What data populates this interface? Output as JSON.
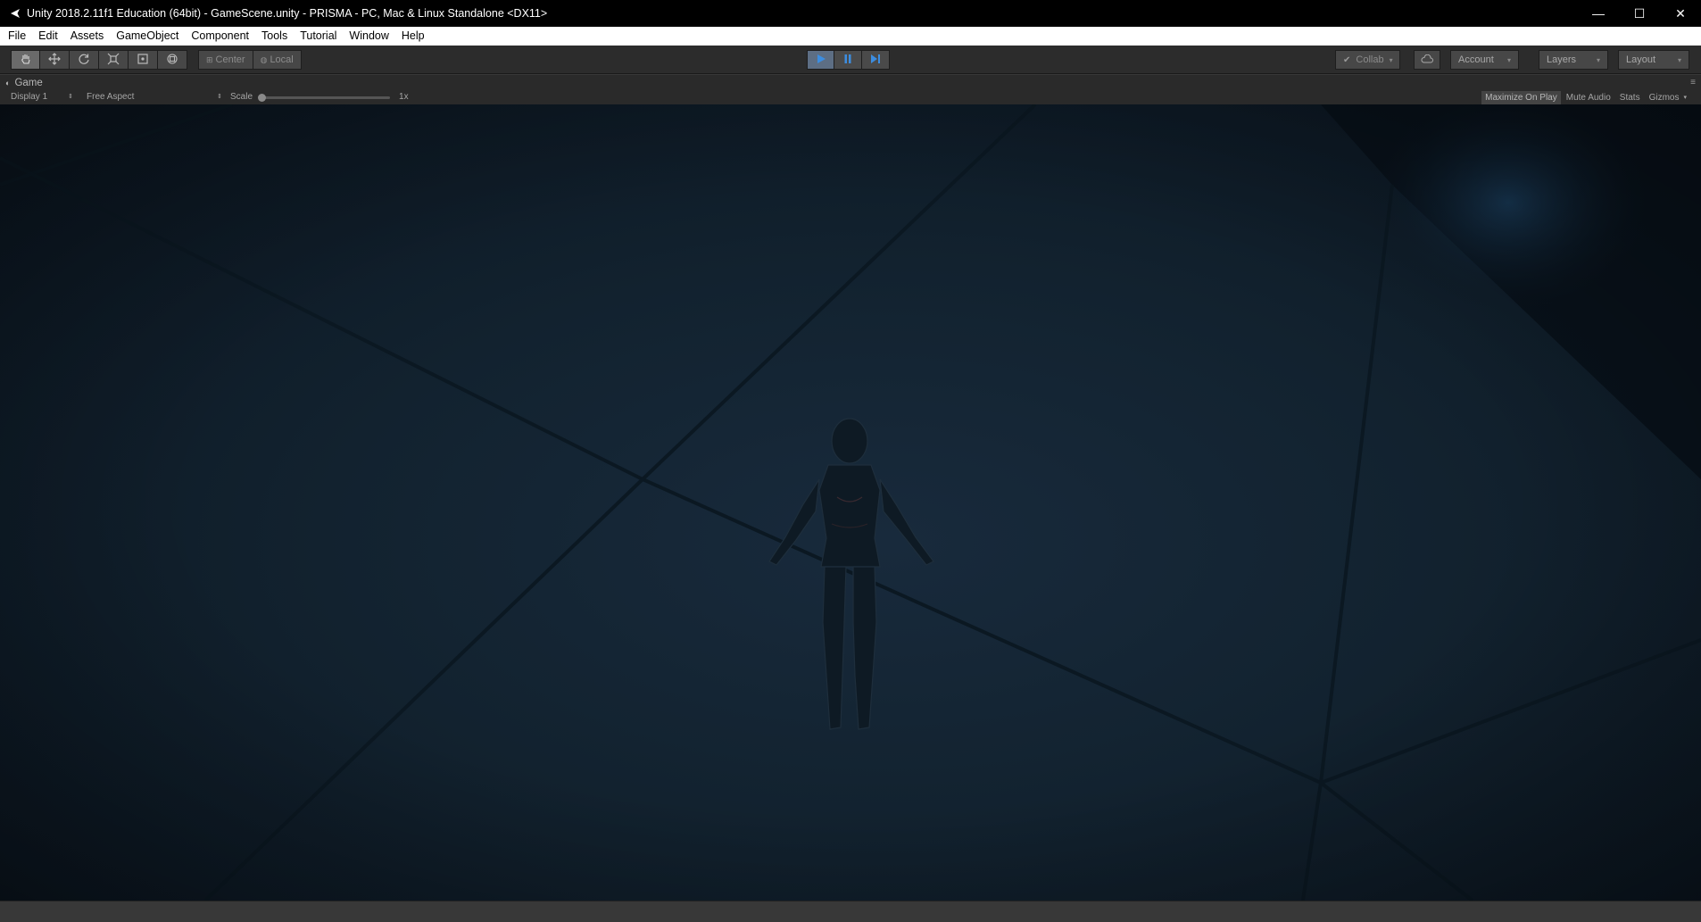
{
  "window": {
    "title": "Unity 2018.2.11f1 Education (64bit) - GameScene.unity - PRISMA - PC, Mac & Linux Standalone <DX11>",
    "minimize_glyph": "—",
    "maximize_glyph": "☐",
    "close_glyph": "✕"
  },
  "menu": {
    "items": [
      "File",
      "Edit",
      "Assets",
      "GameObject",
      "Component",
      "Tools",
      "Tutorial",
      "Window",
      "Help"
    ]
  },
  "toolbar": {
    "tools": [
      {
        "name": "hand-tool",
        "icon": "hand-icon",
        "active": true
      },
      {
        "name": "move-tool",
        "icon": "move-arrows-icon",
        "active": false
      },
      {
        "name": "rotate-tool",
        "icon": "rotate-icon",
        "active": false
      },
      {
        "name": "scale-tool",
        "icon": "scale-icon",
        "active": false
      },
      {
        "name": "rect-tool",
        "icon": "rect-icon",
        "active": false
      },
      {
        "name": "transform-tool",
        "icon": "transform-icon",
        "active": false
      }
    ],
    "pivot_label": "Center",
    "space_label": "Local",
    "play": {
      "playing": true,
      "paused": false
    },
    "collab_label": "Collab",
    "account_label": "Account",
    "layers_label": "Layers",
    "layout_label": "Layout",
    "accent_color": "#3c8de0"
  },
  "game_tab": {
    "label": "Game"
  },
  "game_toolbar": {
    "display": "Display 1",
    "aspect": "Free Aspect",
    "scale_label": "Scale",
    "scale_value": "1x",
    "maximize_on_play": "Maximize On Play",
    "mute_audio": "Mute Audio",
    "stats": "Stats",
    "gizmos": "Gizmos"
  }
}
